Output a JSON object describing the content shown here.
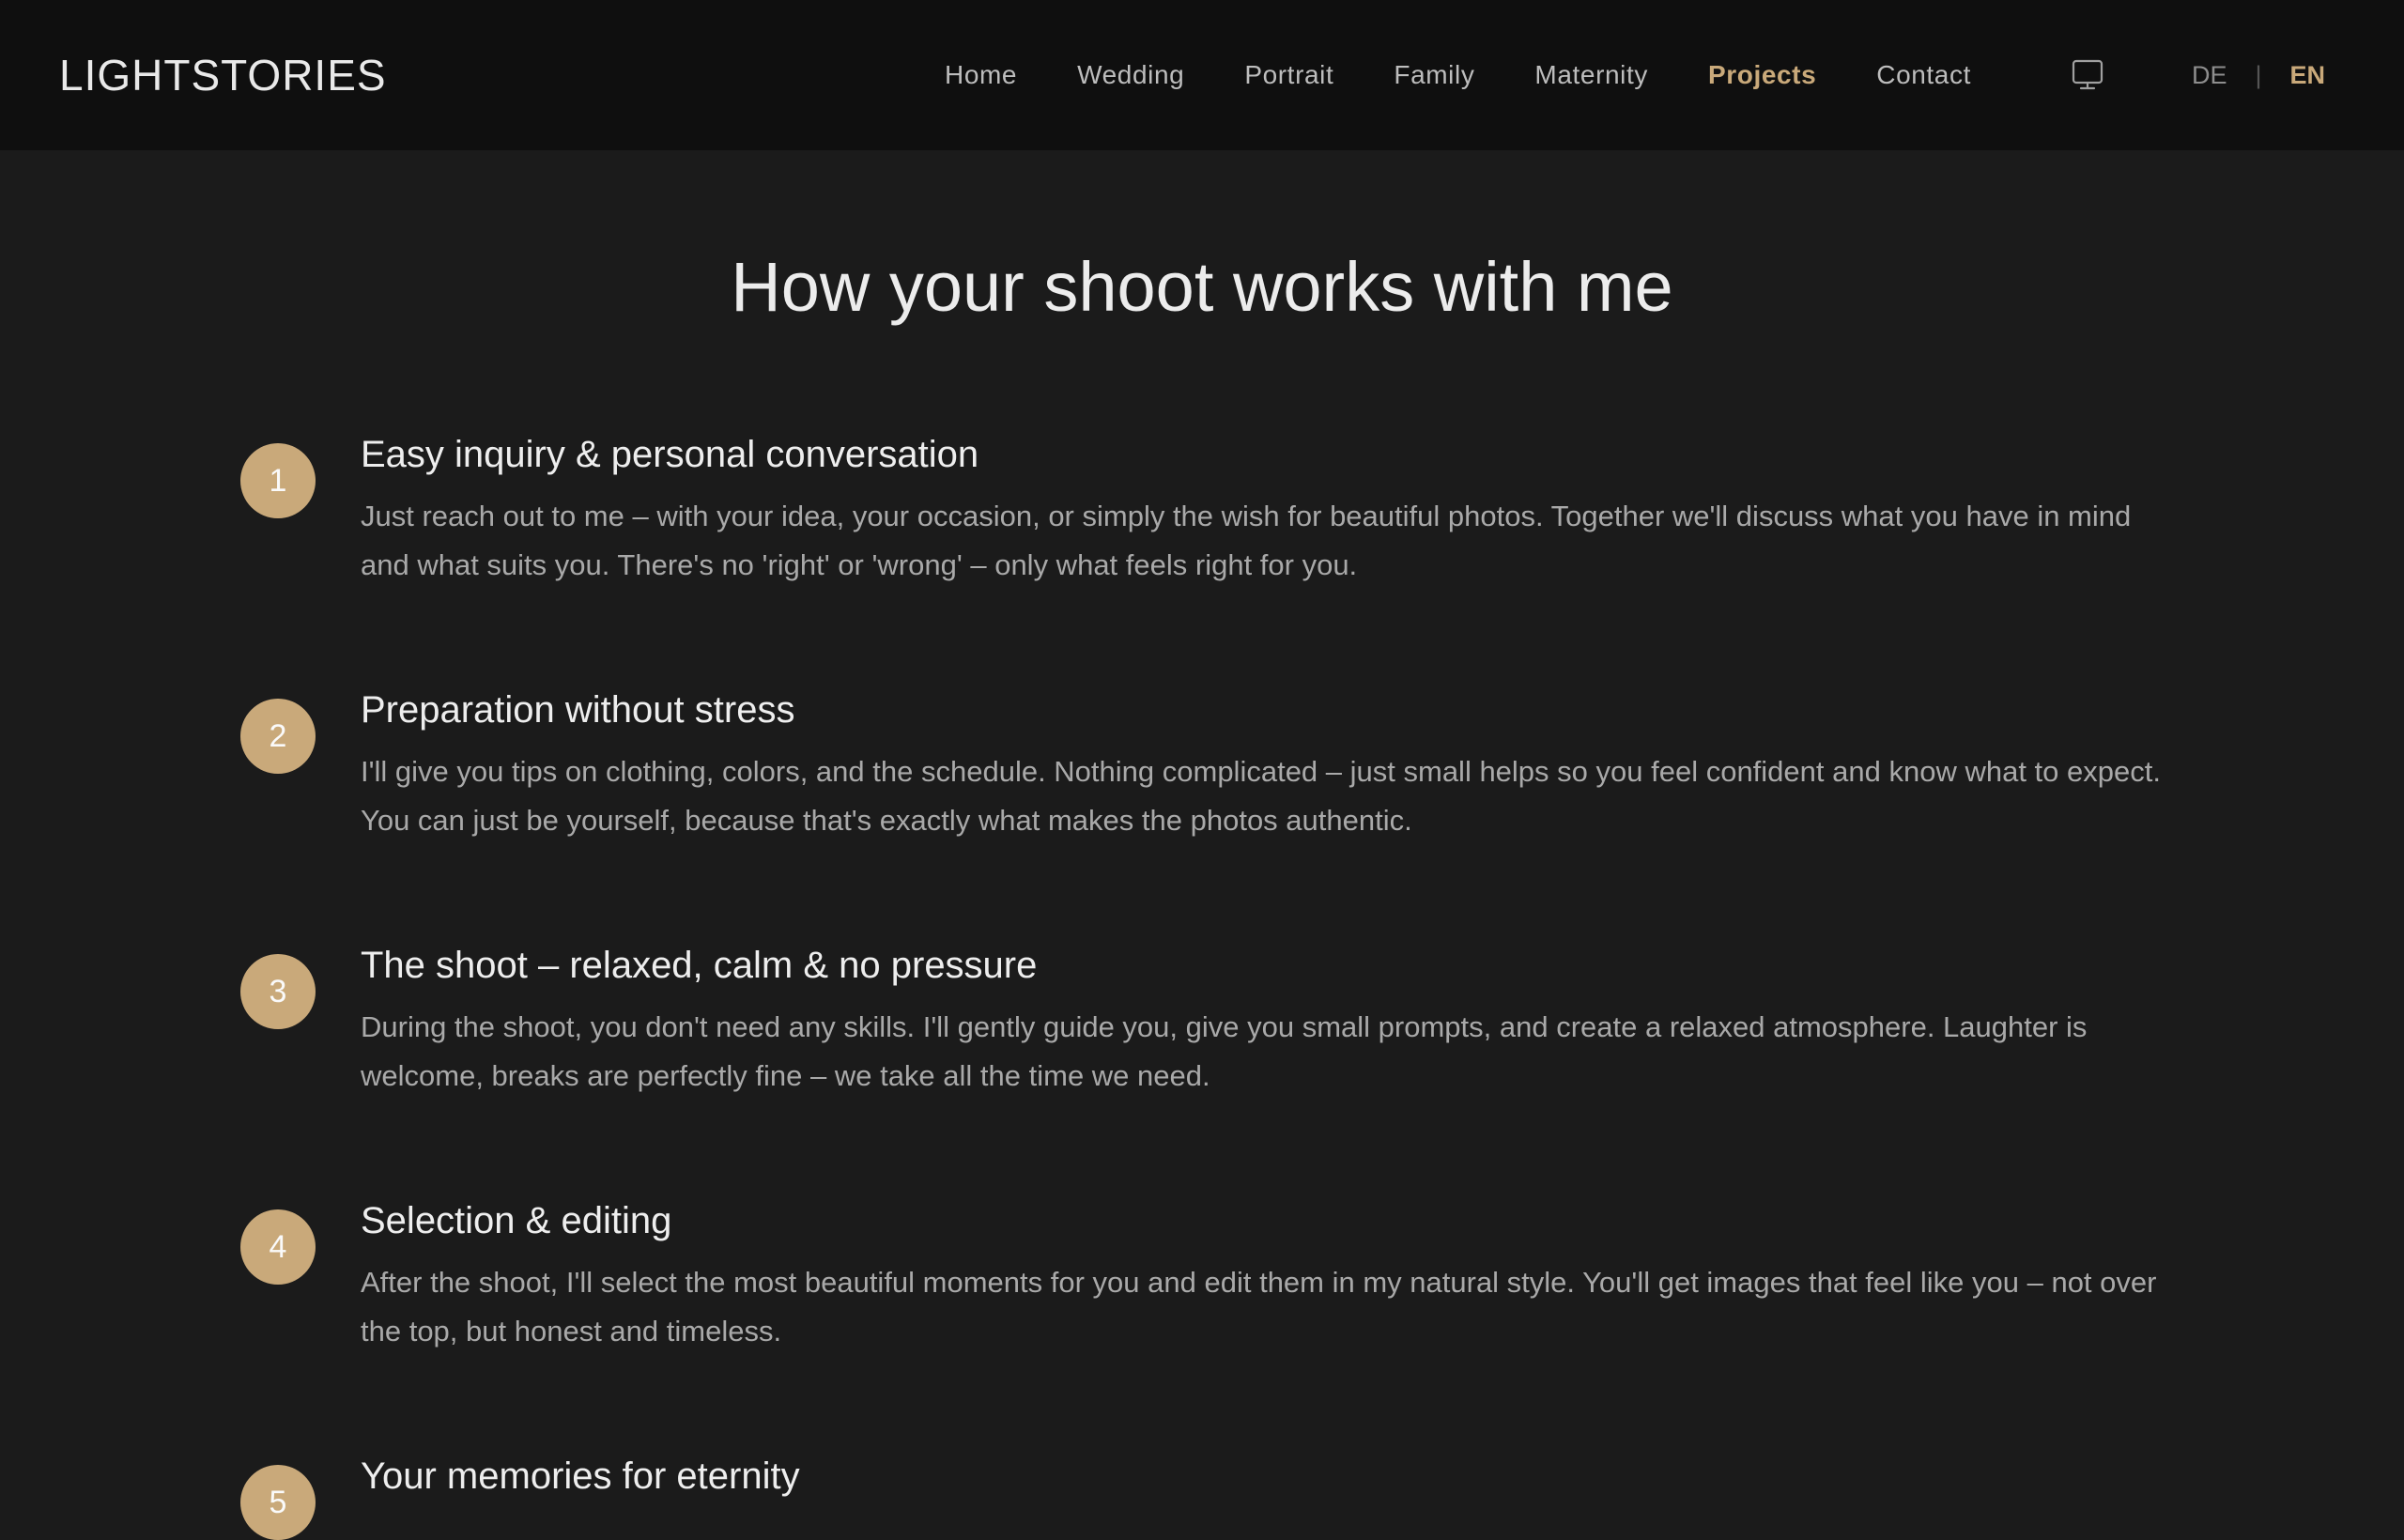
{
  "header": {
    "logo": "LIGHTSTORIES",
    "nav": [
      "Home",
      "Wedding",
      "Portrait",
      "Family",
      "Maternity",
      "Projects",
      "Contact"
    ],
    "active_nav": "Projects",
    "monitor_icon": "monitor-icon",
    "lang": {
      "de": "DE",
      "separator": "|",
      "en": "EN",
      "active": "EN"
    }
  },
  "main": {
    "title": "How your shoot works with me",
    "steps": [
      {
        "number": "1",
        "title": "Easy inquiry & personal conversation",
        "text": "Just reach out to me – with your idea, your occasion, or simply the wish for beautiful photos. Together we'll discuss what you have in mind and what suits you. There's no 'right' or 'wrong' – only what feels right for you."
      },
      {
        "number": "2",
        "title": "Preparation without stress",
        "text": "I'll give you tips on clothing, colors, and the schedule. Nothing complicated – just small helps so you feel confident and know what to expect. You can just be yourself, because that's exactly what makes the photos authentic."
      },
      {
        "number": "3",
        "title": "The shoot – relaxed, calm & no pressure",
        "text": "During the shoot, you don't need any skills. I'll gently guide you, give you small prompts, and create a relaxed atmosphere. Laughter is welcome, breaks are perfectly fine – we take all the time we need."
      },
      {
        "number": "4",
        "title": "Selection & editing",
        "text": "After the shoot, I'll select the most beautiful moments for you and edit them in my natural style. You'll get images that feel like you – not over the top, but honest and timeless."
      },
      {
        "number": "5",
        "title": "Your memories for eternity",
        "text": ""
      }
    ]
  },
  "colors": {
    "accent": "#c9a97a",
    "background": "#1b1b1b",
    "header_background": "#0f0f0f"
  }
}
